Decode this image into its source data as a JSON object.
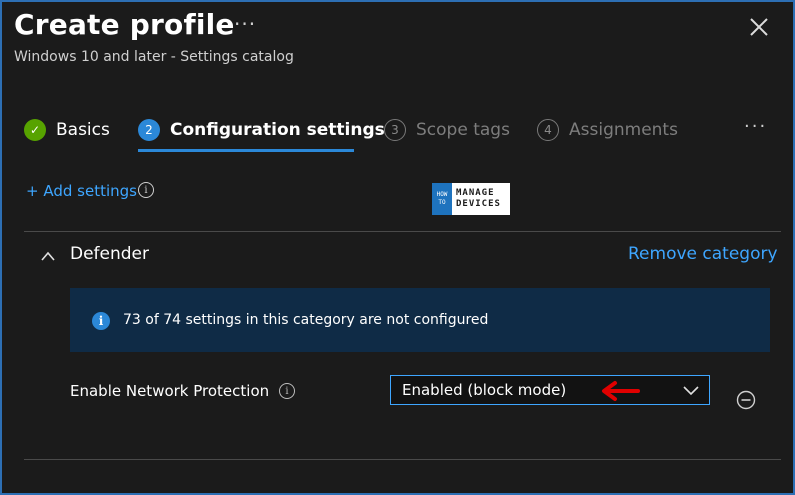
{
  "header": {
    "title": "Create profile",
    "more": "···",
    "subtitle": "Windows 10 and later - Settings catalog"
  },
  "tabs": [
    {
      "label": "Basics",
      "step": "✓",
      "state": "done"
    },
    {
      "label": "Configuration settings",
      "step": "2",
      "state": "active"
    },
    {
      "label": "Scope tags",
      "step": "3",
      "state": "todo"
    },
    {
      "label": "Assignments",
      "step": "4",
      "state": "todo"
    }
  ],
  "tabs_more": "···",
  "add_settings": {
    "label": "+ Add settings",
    "info": "i"
  },
  "logo": {
    "top_left": "HOW",
    "bottom_left": "TO",
    "line1": "MANAGE",
    "line2": "DEVICES"
  },
  "category": {
    "name": "Defender",
    "remove_label": "Remove category",
    "banner_icon": "i",
    "banner_text": "73 of 74 settings in this category are not configured"
  },
  "setting": {
    "label": "Enable Network Protection",
    "info": "i",
    "value": "Enabled (block mode)"
  },
  "colors": {
    "accent": "#2b88d8",
    "link": "#3ea6ff",
    "success": "#57a300",
    "banner": "#0f2b46",
    "annotation": "#e00000"
  }
}
